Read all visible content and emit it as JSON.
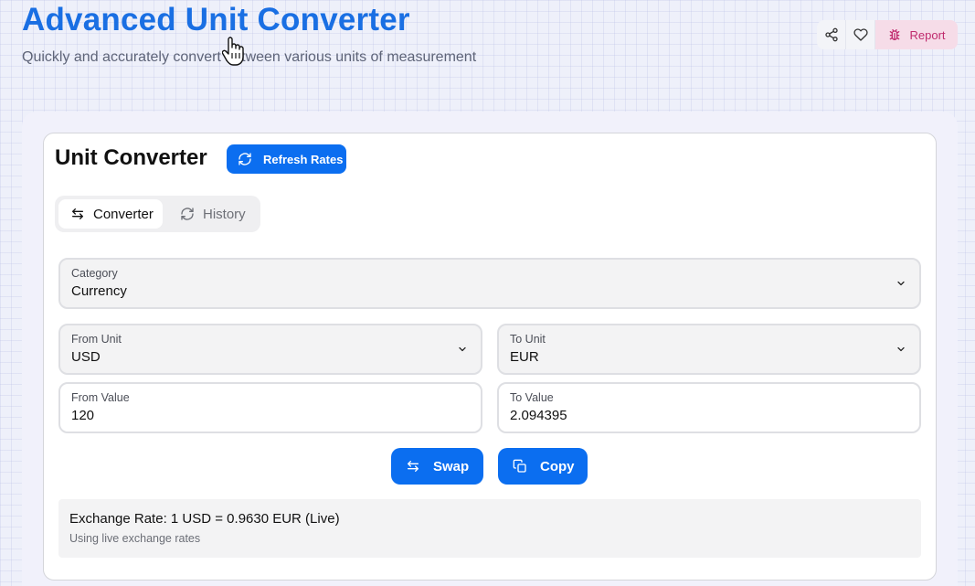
{
  "header": {
    "title": "Advanced Unit Converter",
    "subtitle": "Quickly and accurately convert between various units of measurement"
  },
  "top_actions": {
    "share_icon": "share-icon",
    "heart_icon": "heart-icon",
    "report_label": "Report",
    "report_icon": "bug-icon",
    "report_color": "#c02b6e"
  },
  "card": {
    "title": "Unit Converter",
    "refresh_label": "Refresh Rates"
  },
  "tabs": [
    {
      "label": "Converter",
      "icon": "swap-arrows-icon",
      "active": true
    },
    {
      "label": "History",
      "icon": "refresh-icon",
      "active": false
    }
  ],
  "category": {
    "label": "Category",
    "value": "Currency"
  },
  "from_unit": {
    "label": "From Unit",
    "value": "USD"
  },
  "to_unit": {
    "label": "To Unit",
    "value": "EUR"
  },
  "from_value": {
    "label": "From Value",
    "value": "120"
  },
  "to_value": {
    "label": "To Value",
    "value": "2.094395"
  },
  "buttons": {
    "swap_label": "Swap",
    "copy_label": "Copy"
  },
  "rate": {
    "text": "Exchange Rate: 1 USD = 0.9630 EUR (Live)",
    "note": "Using live exchange rates"
  },
  "colors": {
    "accent": "#0b6ef0",
    "title": "#1a6fe3"
  }
}
